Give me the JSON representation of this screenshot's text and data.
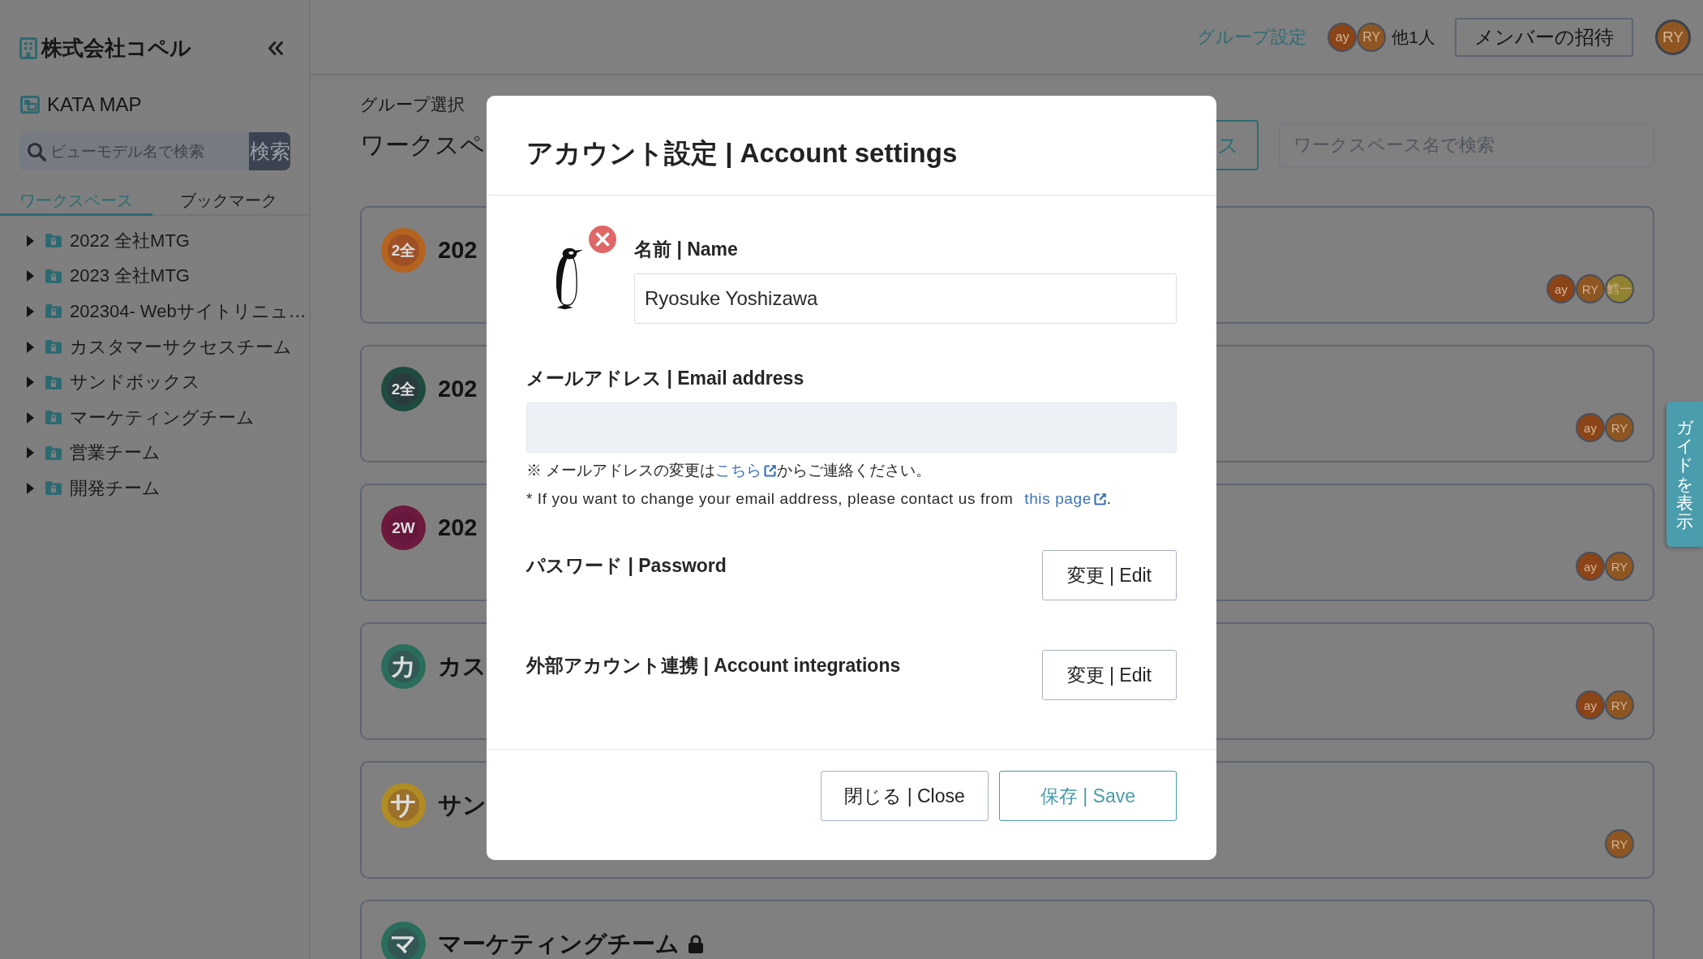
{
  "sidebar": {
    "company": "株式会社コペル",
    "app_name": "KATA MAP",
    "search": {
      "placeholder": "ビューモデル名で検索",
      "button": "検索"
    },
    "tabs": [
      {
        "label": "ワークスペース",
        "selected": true
      },
      {
        "label": "ブックマーク",
        "selected": false
      }
    ],
    "tree": [
      {
        "label": "2022 全社MTG",
        "expanded": false
      },
      {
        "label": "2023 全社MTG",
        "expanded": false
      },
      {
        "label": "202304- Webサイトリニュ…",
        "expanded": false
      },
      {
        "label": "カスタマーサクセスチーム",
        "expanded": false
      },
      {
        "label": "サンドボックス",
        "expanded": false
      },
      {
        "label": "マーケティングチーム",
        "expanded": false
      },
      {
        "label": "営業チーム",
        "expanded": false
      },
      {
        "label": "開発チーム",
        "expanded": false
      }
    ]
  },
  "topbar": {
    "group_settings": "グループ設定",
    "members": [
      {
        "initials": "ay",
        "color": "#8b4418"
      },
      {
        "initials": "RY",
        "color": "#8d5622"
      }
    ],
    "others": "他1人",
    "invite_button": "メンバーの招待",
    "user": {
      "initials": "RY",
      "color": "#8d5622"
    }
  },
  "main": {
    "caption": "グループ選択",
    "title": "ワークスペ",
    "action_button": "ス",
    "search": {
      "placeholder": "ワークスペース名で検索"
    },
    "workspaces": [
      {
        "badge": "2全",
        "color": "#b5641f",
        "title": "202",
        "locked": false,
        "members": [
          {
            "initials": "ay",
            "color": "#8b4418"
          },
          {
            "initials": "RY",
            "color": "#8d5622"
          },
          {
            "initials": "鱈一",
            "color": "#8f8230"
          }
        ]
      },
      {
        "badge": "2全",
        "color": "#1f4a40",
        "title": "202",
        "locked": false,
        "members": [
          {
            "initials": "ay",
            "color": "#8b4418"
          },
          {
            "initials": "RY",
            "color": "#8d5622"
          }
        ]
      },
      {
        "badge": "2W",
        "color": "#6e1a3e",
        "title": "202",
        "locked": false,
        "members": [
          {
            "initials": "ay",
            "color": "#8b4418"
          },
          {
            "initials": "RY",
            "color": "#8d5622"
          }
        ]
      },
      {
        "badge": "カ",
        "color": "#2a6d5c",
        "title": "カス",
        "locked": false,
        "members": [
          {
            "initials": "ay",
            "color": "#8b4418"
          },
          {
            "initials": "RY",
            "color": "#8d5622"
          }
        ]
      },
      {
        "badge": "サ",
        "color": "#b08c24",
        "title": "サン",
        "locked": false,
        "members": [
          {
            "initials": "RY",
            "color": "#8d5622"
          }
        ]
      },
      {
        "badge": "マ",
        "color": "#2a6d5c",
        "title": "マーケティングチーム",
        "locked": true
      }
    ]
  },
  "guide_tab": "ガイドを表示",
  "modal": {
    "title": "アカウント設定 | Account settings",
    "name": {
      "label": "名前 | Name",
      "value": "Ryosuke Yoshizawa"
    },
    "email": {
      "label": "メールアドレス | Email address",
      "disabled": true
    },
    "notes": [
      {
        "before": "※ メールアドレスの変更は",
        "link": "こちら",
        "after": "からご連絡ください。"
      },
      {
        "before": "* If you want to change your email address, please contact us from ",
        "link": "this page",
        "after": "."
      }
    ],
    "settings": [
      {
        "label": "パスワード | Password",
        "button": "変更 | Edit"
      },
      {
        "label": "外部アカウント連携 | Account integrations",
        "button": "変更 | Edit"
      }
    ],
    "buttons": [
      {
        "label": "閉じる | Close",
        "kind": "secondary"
      },
      {
        "label": "保存 | Save",
        "kind": "primary"
      }
    ]
  }
}
